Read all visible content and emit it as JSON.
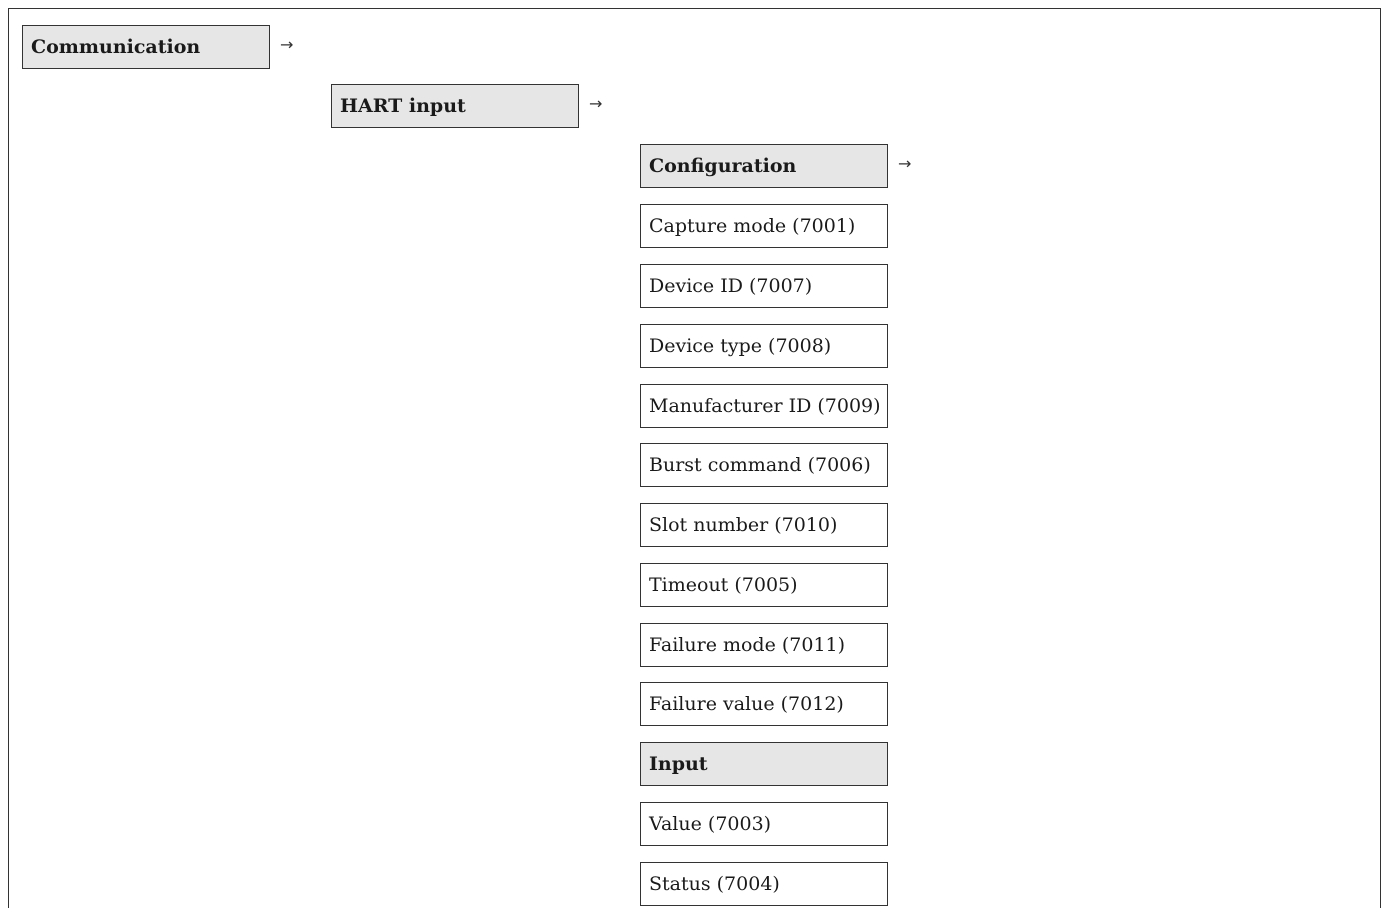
{
  "menu": {
    "level1": {
      "label": "Communication",
      "arrow": "→"
    },
    "level2": {
      "label": "HART input",
      "arrow": "→"
    },
    "level3": {
      "items": [
        {
          "label": "Configuration",
          "header": true,
          "arrow": "→"
        },
        {
          "label": "Capture mode (7001)",
          "header": false
        },
        {
          "label": "Device ID (7007)",
          "header": false
        },
        {
          "label": "Device type (7008)",
          "header": false
        },
        {
          "label": "Manufacturer ID (7009)",
          "header": false
        },
        {
          "label": "Burst command (7006)",
          "header": false
        },
        {
          "label": "Slot number (7010)",
          "header": false
        },
        {
          "label": "Timeout (7005)",
          "header": false
        },
        {
          "label": "Failure mode (7011)",
          "header": false
        },
        {
          "label": "Failure value (7012)",
          "header": false
        },
        {
          "label": "Input",
          "header": true
        },
        {
          "label": "Value (7003)",
          "header": false
        },
        {
          "label": "Status (7004)",
          "header": false
        }
      ]
    }
  }
}
